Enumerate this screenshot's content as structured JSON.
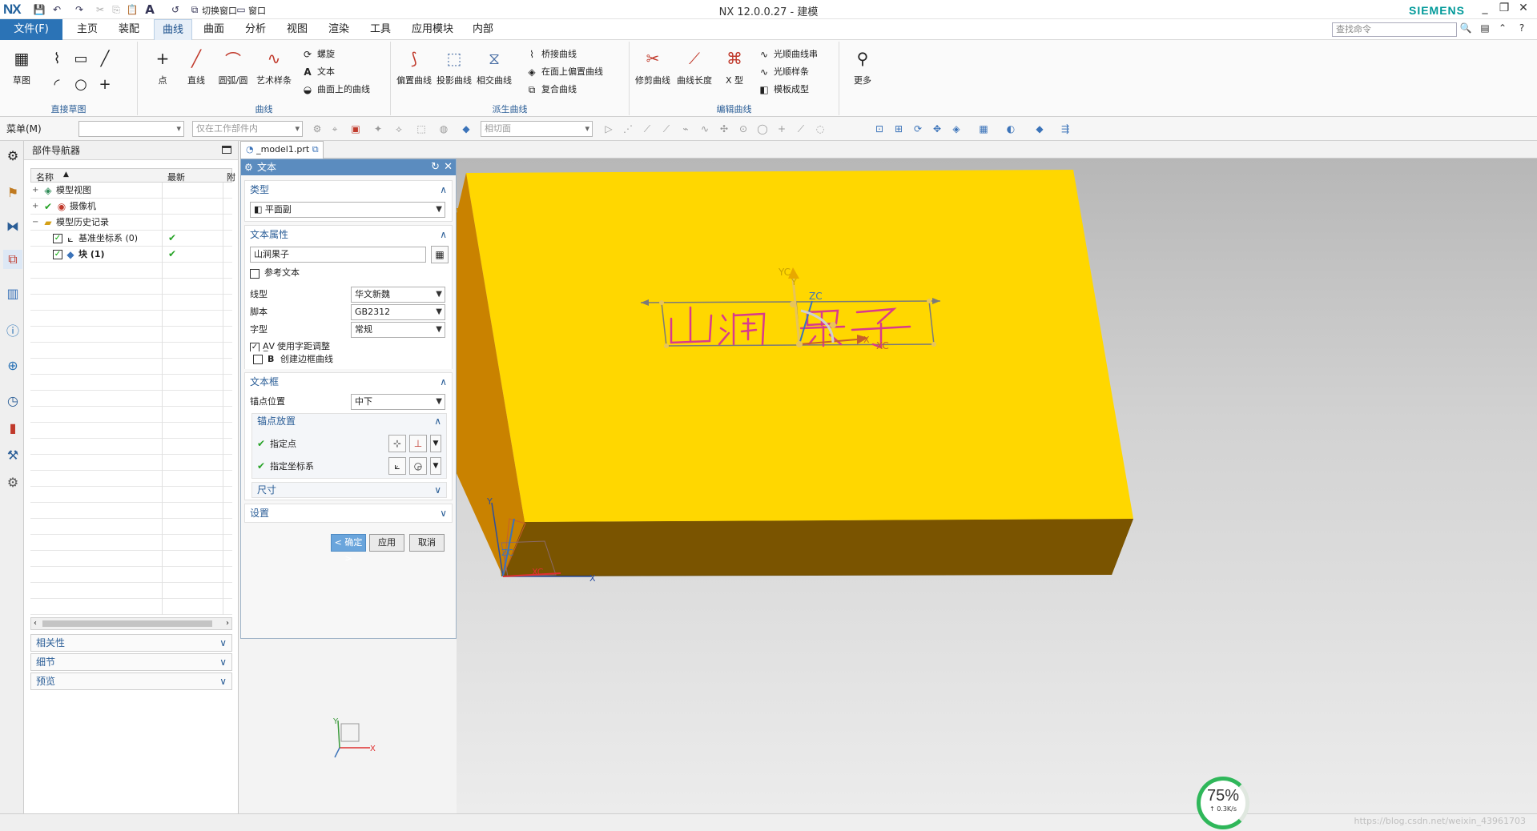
{
  "window": {
    "app_logo": "NX",
    "title": "NX 12.0.0.27 - 建模",
    "brand": "SIEMENS",
    "controls": [
      "_",
      "❐",
      "✕"
    ]
  },
  "menubar": {
    "file_label": "文件(F)",
    "tabs": [
      "主页",
      "装配",
      "曲线",
      "曲面",
      "分析",
      "视图",
      "渲染",
      "工具",
      "应用模块",
      "内部"
    ],
    "active_tab": "曲线",
    "search_placeholder": "查找命令",
    "switch_window": "切换窗口",
    "window_menu": "窗口"
  },
  "ribbon": {
    "groups": {
      "direct_sketch": "直接草图",
      "curve": "曲线",
      "derived": "派生曲线",
      "edit": "编辑曲线"
    },
    "sketch_label": "草图",
    "point_label": "点",
    "line_label": "直线",
    "arc_label": "圆弧/圆",
    "spline_label": "艺术样条",
    "helix_label": "螺旋",
    "text_label": "文本",
    "curve_on_surface": "曲面上的曲线",
    "offset_curve": "偏置曲线",
    "project_curve": "投影曲线",
    "intersect_curve": "相交曲线",
    "bridge_curve": "桥接曲线",
    "offset_on_face": "在面上偏置曲线",
    "composite_curve": "复合曲线",
    "trim_curve": "修剪曲线",
    "curve_length": "曲线长度",
    "x_form": "X 型",
    "smooth_string": "光顺曲线串",
    "smooth_spline": "光顺样条",
    "template_shape": "模板成型",
    "more": "更多"
  },
  "seltool": {
    "menu_label": "菜单(M)",
    "filter_value": "",
    "scope_value": "仅在工作部件内",
    "snap_value": "相切面"
  },
  "navigator": {
    "title": "部件导航器",
    "col_name": "名称",
    "col_latest": "最新",
    "col_extra": "附",
    "rows": [
      {
        "label": "模型视图"
      },
      {
        "label": "摄像机"
      },
      {
        "label": "模型历史记录"
      },
      {
        "label": "基准坐标系 (0)"
      },
      {
        "label": "块 (1)"
      }
    ],
    "panels": [
      "相关性",
      "细节",
      "预览"
    ]
  },
  "graphics_tab": {
    "label": "_model1.prt"
  },
  "dialog": {
    "title": "文本",
    "type_section": "类型",
    "type_value": "平面副",
    "props_section": "文本属性",
    "text_value": "山涧果子",
    "ref_text_label": "参考文本",
    "linetype_label": "线型",
    "linetype_value": "华文新魏",
    "script_label": "脚本",
    "script_value": "GB2312",
    "style_label": "字型",
    "style_value": "常规",
    "kerning_label": "使用字距调整",
    "kerning_checked": true,
    "frame_curve_label": "创建边框曲线",
    "box_section": "文本框",
    "anchor_label": "锚点位置",
    "anchor_value": "中下",
    "anchor_place_section": "锚点放置",
    "specify_point": "指定点",
    "specify_csys": "指定坐标系",
    "size_section": "尺寸",
    "settings_section": "设置",
    "ok": "< 确定 >",
    "apply": "应用",
    "cancel": "取消"
  },
  "viewport": {
    "block_top_color": "#FFD700",
    "block_side_color": "#B8860B",
    "text_color": "#D93A8C",
    "labels": {
      "yc": "YC",
      "y": "Y",
      "zc": "ZC",
      "x": "X",
      "xc": "XC",
      "z_origin": "ZC",
      "x_axis": "X",
      "y_axis": "Y",
      "xc_origin": "XC"
    }
  },
  "meter": {
    "percent": "75%",
    "speed": "↑ 0.3K/s"
  },
  "watermark": "https://blog.csdn.net/weixin_43961703"
}
